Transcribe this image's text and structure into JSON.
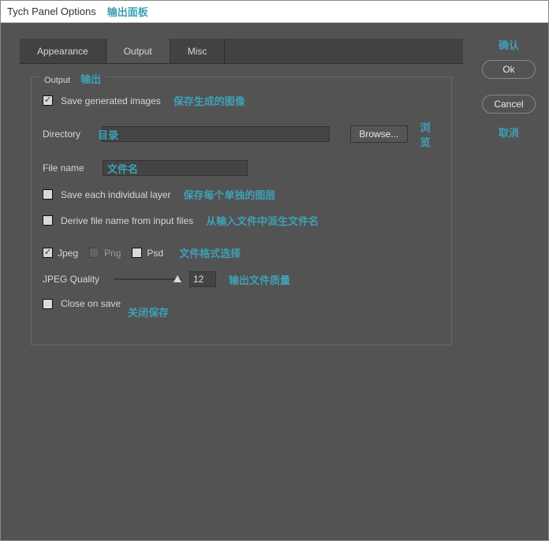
{
  "window": {
    "title": "Tych Panel Options",
    "title_zh": "输出面板"
  },
  "tabs": {
    "appearance": "Appearance",
    "output": "Output",
    "misc": "Misc",
    "active": "output"
  },
  "fieldset": {
    "legend": "Output",
    "legend_zh": "输出"
  },
  "save_generated": {
    "label": "Save generated images",
    "zh": "保存生成的图像",
    "checked": true
  },
  "directory": {
    "label": "Directory",
    "zh": "目录",
    "value": "",
    "browse": "Browse...",
    "browse_zh": "浏览"
  },
  "filename": {
    "label": "File name",
    "zh": "文件名",
    "value": ""
  },
  "save_each": {
    "label": "Save each individual layer",
    "zh": "保存每个单独的图层",
    "checked": false
  },
  "derive": {
    "label": "Derive file name from input files",
    "zh": "从输入文件中派生文件名",
    "checked": false
  },
  "formats": {
    "jpeg": {
      "label": "Jpeg",
      "checked": true
    },
    "png": {
      "label": "Png",
      "checked": false,
      "disabled": true
    },
    "psd": {
      "label": "Psd",
      "checked": false
    },
    "zh": "文件格式选择"
  },
  "quality": {
    "label": "JPEG Quality",
    "value": "12",
    "zh": "输出文件质量"
  },
  "close_on_save": {
    "label": "Close on save",
    "zh": "关闭保存",
    "checked": false
  },
  "buttons": {
    "ok": "Ok",
    "ok_zh": "确认",
    "cancel": "Cancel",
    "cancel_zh": "取消"
  }
}
